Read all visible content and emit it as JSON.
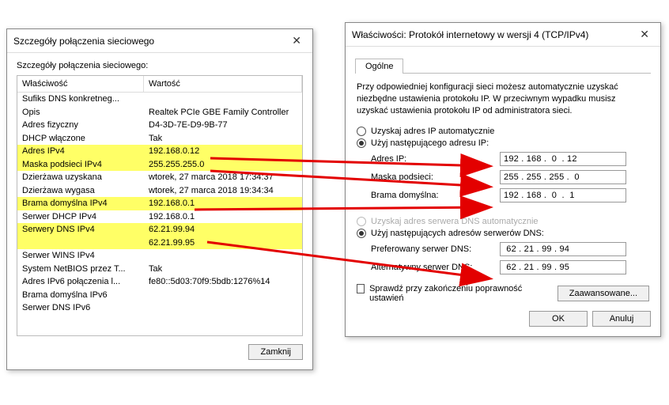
{
  "left": {
    "title": "Szczegóły połączenia sieciowego",
    "subtitle": "Szczegóły połączenia sieciowego:",
    "header_property": "Właściwość",
    "header_value": "Wartość",
    "rows": [
      {
        "p": "Sufiks DNS konkretneg...",
        "v": "",
        "hl": false
      },
      {
        "p": "Opis",
        "v": "Realtek PCIe GBE Family Controller",
        "hl": false
      },
      {
        "p": "Adres fizyczny",
        "v": "D4-3D-7E-D9-9B-77",
        "hl": false
      },
      {
        "p": "DHCP włączone",
        "v": "Tak",
        "hl": false
      },
      {
        "p": "Adres IPv4",
        "v": "192.168.0.12",
        "hl": true
      },
      {
        "p": "Maska podsieci IPv4",
        "v": "255.255.255.0",
        "hl": true
      },
      {
        "p": "Dzierżawa uzyskana",
        "v": "wtorek, 27 marca 2018 17:34:37",
        "hl": false
      },
      {
        "p": "Dzierżawa wygasa",
        "v": "wtorek, 27 marca 2018 19:34:34",
        "hl": false
      },
      {
        "p": "Brama domyślna IPv4",
        "v": "192.168.0.1",
        "hl": true
      },
      {
        "p": "Serwer DHCP IPv4",
        "v": "192.168.0.1",
        "hl": false
      },
      {
        "p": "Serwery DNS IPv4",
        "v": "62.21.99.94",
        "hl": true
      },
      {
        "p": "",
        "v": "62.21.99.95",
        "hl": true
      },
      {
        "p": "Serwer WINS IPv4",
        "v": "",
        "hl": false
      },
      {
        "p": "System NetBIOS przez T...",
        "v": "Tak",
        "hl": false
      },
      {
        "p": "Adres IPv6 połączenia l...",
        "v": "fe80::5d03:70f9:5bdb:1276%14",
        "hl": false
      },
      {
        "p": "Brama domyślna IPv6",
        "v": "",
        "hl": false
      },
      {
        "p": "Serwer DNS IPv6",
        "v": "",
        "hl": false
      }
    ],
    "close_btn": "Zamknij"
  },
  "right": {
    "title": "Właściwości: Protokół internetowy w wersji 4 (TCP/IPv4)",
    "tab_general": "Ogólne",
    "description": "Przy odpowiedniej konfiguracji sieci możesz automatycznie uzyskać niezbędne ustawienia protokołu IP. W przeciwnym wypadku musisz uzyskać ustawienia protokołu IP od administratora sieci.",
    "radio_ip_auto": "Uzyskaj adres IP automatycznie",
    "radio_ip_manual": "Użyj następującego adresu IP:",
    "label_ip": "Adres IP:",
    "value_ip": "192 . 168 .  0  . 12",
    "label_mask": "Maska podsieci:",
    "value_mask": "255 . 255 . 255 .  0",
    "label_gw": "Brama domyślna:",
    "value_gw": "192 . 168 .  0  .  1",
    "radio_dns_auto": "Uzyskaj adres serwera DNS automatycznie",
    "radio_dns_manual": "Użyj następujących adresów serwerów DNS:",
    "label_dns1": "Preferowany serwer DNS:",
    "value_dns1": " 62 . 21 . 99 . 94",
    "label_dns2": "Alternatywny serwer DNS:",
    "value_dns2": " 62 . 21 . 99 . 95",
    "checkbox_validate": "Sprawdź przy zakończeniu poprawność ustawień",
    "btn_advanced": "Zaawansowane...",
    "btn_ok": "OK",
    "btn_cancel": "Anuluj"
  }
}
